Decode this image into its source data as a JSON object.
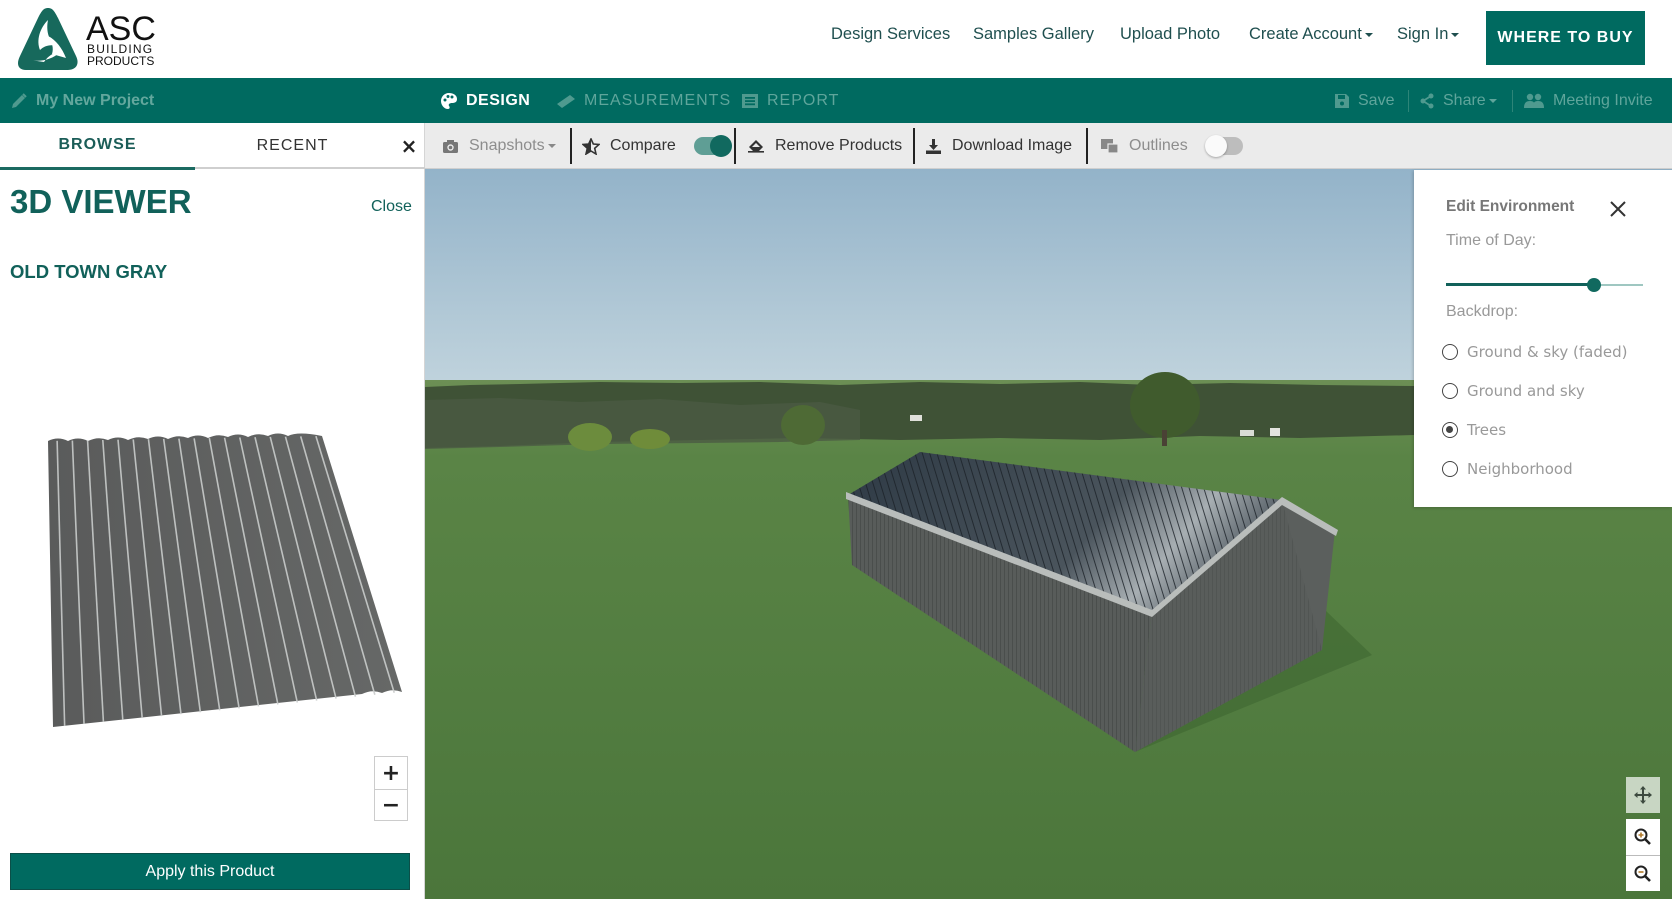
{
  "header": {
    "logo": {
      "main": "ASC",
      "line1": "BUILDING",
      "line2": "PRODUCTS",
      "icon": "asc-triangle-logo"
    },
    "nav": [
      {
        "label": "Design Services",
        "dropdown": false
      },
      {
        "label": "Samples Gallery",
        "dropdown": false
      },
      {
        "label": "Upload Photo",
        "dropdown": false
      },
      {
        "label": "Create Account",
        "dropdown": true
      },
      {
        "label": "Sign In",
        "dropdown": true
      }
    ],
    "cta_label": "WHERE TO BUY"
  },
  "projectbar": {
    "project_name": "My New Project",
    "project_icon": "pencil-icon",
    "tabs": [
      {
        "label": "DESIGN",
        "icon": "palette-icon",
        "active": true
      },
      {
        "label": "MEASUREMENTS",
        "icon": "ruler-icon",
        "active": false
      },
      {
        "label": "REPORT",
        "icon": "list-icon",
        "active": false
      }
    ],
    "actions": [
      {
        "label": "Save",
        "icon": "save-icon"
      },
      {
        "label": "Share",
        "icon": "share-icon",
        "dropdown": true
      },
      {
        "label": "Meeting Invite",
        "icon": "users-icon"
      }
    ]
  },
  "leftpanel": {
    "tabs": [
      {
        "label": "BROWSE",
        "active": true
      },
      {
        "label": "RECENT",
        "active": false
      }
    ],
    "close_glyph": "×",
    "viewer_title": "3D VIEWER",
    "viewer_close": "Close",
    "product_name": "OLD TOWN GRAY",
    "zoom_in": "+",
    "zoom_out": "−",
    "apply_label": "Apply this Product"
  },
  "toolbar": {
    "snapshots": {
      "label": "Snapshots",
      "icon": "camera-icon",
      "dropdown": true,
      "enabled": false
    },
    "compare": {
      "label": "Compare",
      "icon": "star-icon",
      "toggle_on": true
    },
    "remove_products": {
      "label": "Remove Products",
      "icon": "eraser-icon"
    },
    "download_image": {
      "label": "Download Image",
      "icon": "download-icon"
    },
    "outlines": {
      "label": "Outlines",
      "icon": "outlines-icon",
      "toggle_on": false,
      "enabled": false
    }
  },
  "environment": {
    "title": "Edit Environment",
    "time_of_day_label": "Time of Day:",
    "time_of_day_value": 0.75,
    "backdrop_label": "Backdrop:",
    "backdrop_options": [
      {
        "label": "Ground & sky (faded)",
        "selected": false
      },
      {
        "label": "Ground and sky",
        "selected": false
      },
      {
        "label": "Trees",
        "selected": true
      },
      {
        "label": "Neighborhood",
        "selected": false
      }
    ]
  },
  "colors": {
    "brand_teal": "#006a60",
    "dark_teal_text": "#11615a",
    "muted_teal_text": "#5fa59b",
    "sky": "#a7c4d6",
    "grass": "#4f7a3e",
    "metal_gray": "#5a5d5c"
  }
}
